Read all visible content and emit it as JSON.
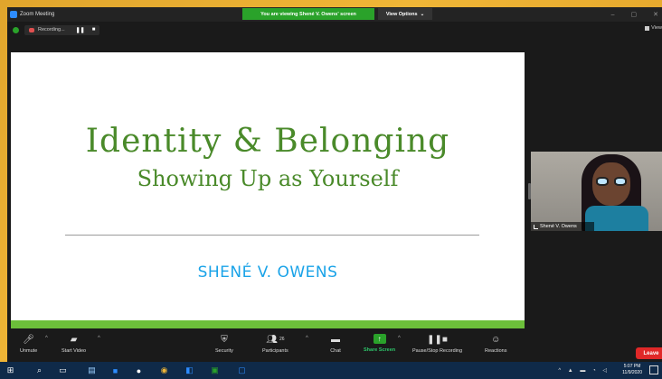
{
  "window": {
    "title": "Zoom Meeting",
    "viewing_banner": "You are viewing Shené V. Owens' screen",
    "view_options": "View Options",
    "view_right": "View"
  },
  "recording": {
    "label": "Recording..."
  },
  "slide": {
    "title": "Identity & Belonging",
    "subtitle": "Showing Up as Yourself",
    "author": "SHENÉ V. OWENS"
  },
  "video": {
    "participant_name": "Shené V. Owens"
  },
  "toolbar": {
    "unmute": "Unmute",
    "start_video": "Start Video",
    "security": "Security",
    "participants": "Participants",
    "participants_count": "26",
    "chat": "Chat",
    "share_screen": "Share Screen",
    "pause_stop_recording": "Pause/Stop Recording",
    "reactions": "Reactions",
    "leave": "Leave"
  },
  "taskbar": {
    "time": "5:07 PM",
    "date": "11/9/2020"
  },
  "colors": {
    "banner_green": "#2aa22a",
    "slide_title_green": "#4a8a2a",
    "author_blue": "#1aa3e8",
    "leave_red": "#e02828"
  }
}
